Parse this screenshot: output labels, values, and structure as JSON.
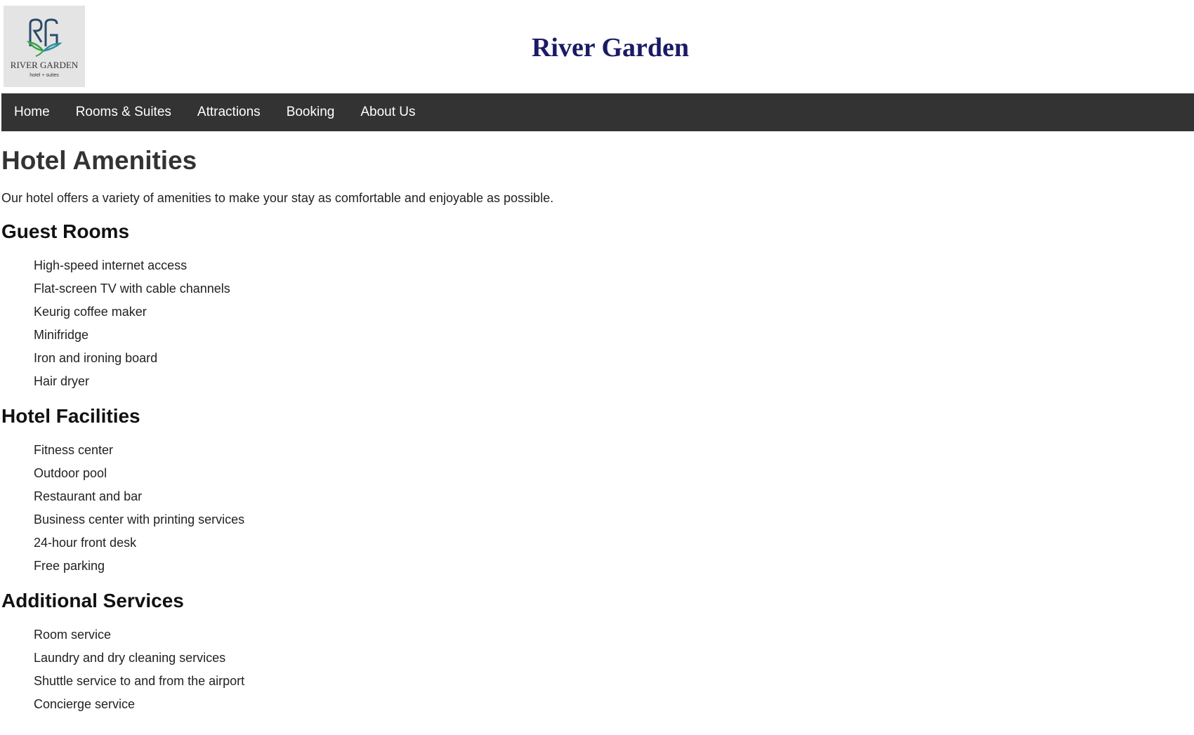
{
  "header": {
    "logo_text": "RIVER GARDEN",
    "logo_subtext": "hotel + suites",
    "logo_monogram": "RG",
    "title": "River Garden"
  },
  "nav": {
    "items": [
      {
        "label": "Home"
      },
      {
        "label": "Rooms & Suites"
      },
      {
        "label": "Attractions"
      },
      {
        "label": "Booking"
      },
      {
        "label": "About Us"
      }
    ]
  },
  "main": {
    "title": "Hotel Amenities",
    "intro": "Our hotel offers a variety of amenities to make your stay as comfortable and enjoyable as possible.",
    "sections": [
      {
        "heading": "Guest Rooms",
        "items": [
          "High-speed internet access",
          "Flat-screen TV with cable channels",
          "Keurig coffee maker",
          "Minifridge",
          "Iron and ironing board",
          "Hair dryer"
        ]
      },
      {
        "heading": "Hotel Facilities",
        "items": [
          "Fitness center",
          "Outdoor pool",
          "Restaurant and bar",
          "Business center with printing services",
          "24-hour front desk",
          "Free parking"
        ]
      },
      {
        "heading": "Additional Services",
        "items": [
          "Room service",
          "Laundry and dry cleaning services",
          "Shuttle service to and from the airport",
          "Concierge service"
        ]
      }
    ]
  },
  "colors": {
    "title": "#1a1a66",
    "navbar_bg": "#333333",
    "logo_bg": "#e4e4e4",
    "logo_teal": "#2e8fa0",
    "logo_green": "#3aa04a"
  }
}
